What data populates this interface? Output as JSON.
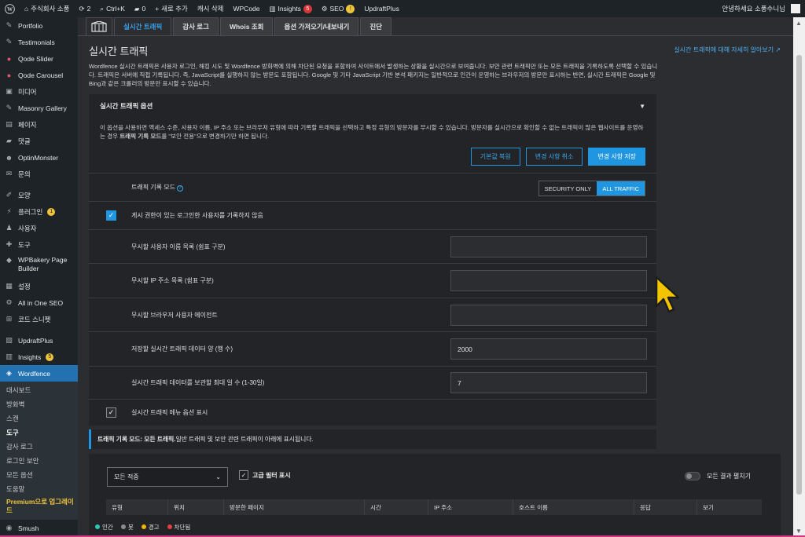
{
  "adminbar": {
    "site_name": "주식회사 소풍",
    "updates_count": "2",
    "shortcut": "Ctrl+K",
    "comments_count": "0",
    "new_label": "새로 추가",
    "cache_clear": "캐시 삭제",
    "wpcode": "WPCode",
    "insights": "Insights",
    "insights_badge": "5",
    "seo": "SEO",
    "seo_badge": "!",
    "updraft": "UpdraftPlus",
    "greeting": "안녕하세요 소풍수니님"
  },
  "sidebar": {
    "items": [
      {
        "label": "Portfolio",
        "icon": "pin-icon"
      },
      {
        "label": "Testimonials",
        "icon": "pin-icon"
      },
      {
        "label": "Qode Slider",
        "icon": "qode-icon"
      },
      {
        "label": "Qode Carousel",
        "icon": "qode-icon"
      },
      {
        "label": "미디어",
        "icon": "media-icon"
      },
      {
        "label": "Masonry Gallery",
        "icon": "pin-icon"
      },
      {
        "label": "페이지",
        "icon": "page-icon"
      },
      {
        "label": "댓글",
        "icon": "comment-icon"
      },
      {
        "label": "OptinMonster",
        "icon": "optinmonster-icon"
      },
      {
        "label": "문의",
        "icon": "mail-icon"
      },
      {
        "label": "모양",
        "icon": "appearance-icon"
      },
      {
        "label": "플러그인",
        "icon": "plugin-icon",
        "badge": "1"
      },
      {
        "label": "사용자",
        "icon": "user-icon"
      },
      {
        "label": "도구",
        "icon": "tool-icon"
      },
      {
        "label": "WPBakery Page Builder",
        "icon": "wpbakery-icon"
      },
      {
        "label": "설정",
        "icon": "settings-icon"
      },
      {
        "label": "All in One SEO",
        "icon": "aioseo-icon"
      },
      {
        "label": "코드 스니펫",
        "icon": "code-icon"
      },
      {
        "label": "UpdraftPlus",
        "icon": "updraft-icon"
      },
      {
        "label": "Insights",
        "icon": "insights-icon",
        "badge": "5"
      },
      {
        "label": "Wordfence",
        "icon": "wordfence-icon"
      }
    ],
    "submenu": [
      "대시보드",
      "방화벽",
      "스캔",
      "도구",
      "감사 로그",
      "로그인 보안",
      "모든 옵션",
      "도움말"
    ],
    "premium": "Premium으로 업그레이드",
    "smush": "Smush"
  },
  "tabs": [
    "실시간 트래픽",
    "감사 로그",
    "Whois 조회",
    "옵션 가져오기/내보내기",
    "진단"
  ],
  "page": {
    "title": "실시간 트래픽",
    "learn_more": "실시간 트래픽에 대해 자세히 알아보기",
    "description": "Wordfence 실시간 트래픽은 사용자 로그인, 해킹 시도 및 Wordfence 방화벽에 의해 차단된 요청을 포함하여 사이트에서 발생하는 상황을 실시간으로 보여줍니다. 보안 관련 트래픽만 또는 모든 트래픽을 기록하도록 선택할 수 있습니다. 트래픽은 서버에 직접 기록됩니다. 즉, JavaScript를 실행하지 않는 방문도 포함됩니다. Google 및 기타 JavaScript 기반 분석 패키지는 일반적으로 인간이 운영하는 브라우저의 방문만 표시하는 반면, 실시간 트래픽은 Google 및 Bing과 같은 크롤러의 방문만 표시할 수 있습니다."
  },
  "options": {
    "title": "실시간 트래픽 옵션",
    "description_a": "이 옵션을 사용하면 액세스 수준, 사용자 이름, IP 주소 또는 브라우저 유형에 따라 기록할 트래픽을 선택하고 특정 유형의 방문자를 무시할 수 있습니다. 방문자를 실시간으로 확인할 수 없는 트래픽이 많은 웹사이트를 운영하는 경우 ",
    "description_bold": "트래픽 기록 모드",
    "description_b": "를 \"보안 전용\"으로 변경하기만 하면 됩니다.",
    "btn_reset": "기본값 복원",
    "btn_cancel": "변경 사항 취소",
    "btn_save": "변경 사항 저장",
    "mode_label": "트래픽 기록 모드",
    "mode_options": [
      "SECURITY ONLY",
      "ALL TRAFFIC"
    ],
    "mode_selected": "ALL TRAFFIC",
    "no_log_label": "게시 권한이 있는 로그인한 사용자를 기록하지 않음",
    "ignore_users_label": "무시할 사용자 이름 목록 (쉼표 구분)",
    "ignore_ips_label": "무시할 IP 주소 목록 (쉼표 구분)",
    "ignore_ua_label": "무시할 브라우저 사용자 에이전트",
    "max_rows_label": "저장할 실시간 트래픽 데이터 양 (행 수)",
    "max_rows_value": "2000",
    "max_days_label": "실시간 트래픽 데이터를 보관할 최대 일 수 (1-30일)",
    "max_days_value": "7",
    "show_menu_label": "실시간 트래픽 메뉴 옵션 표시"
  },
  "mode_banner": {
    "bold": "트래픽 기록 모드: 모든 트래픽.",
    "text": " 일반 트래픽 및 보안 관련 트래픽이 아래에 표시됩니다."
  },
  "filters": {
    "select_value": "모든 적중",
    "advanced": "고급 필터 표시",
    "expand_all": "모든 결과 펼치기"
  },
  "table": {
    "columns": [
      "유형",
      "위치",
      "방문한 페이지",
      "시간",
      "IP 주소",
      "호스트 이름",
      "응답",
      "보기"
    ]
  },
  "legend": [
    {
      "label": "인간",
      "color": "#2fc6b6"
    },
    {
      "label": "봇",
      "color": "#8a8c90"
    },
    {
      "label": "경고",
      "color": "#f0b400"
    },
    {
      "label": "차단됨",
      "color": "#e04040"
    }
  ],
  "colors": {
    "accent": "#2196e0",
    "sidebar_active": "#2271b1"
  }
}
